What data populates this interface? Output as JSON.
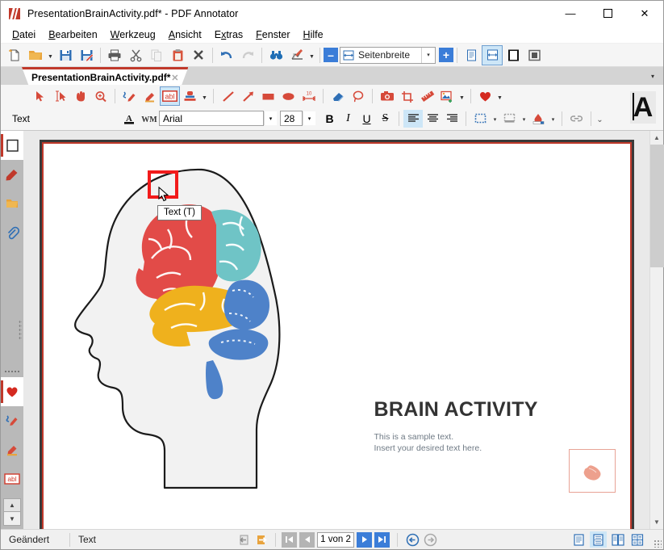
{
  "window": {
    "title": "PresentationBrainActivity.pdf* - PDF Annotator",
    "app_icon": "pdf-annotator-logo-icon",
    "minimize_label": "—",
    "maximize_label": "☐",
    "close_label": "✕"
  },
  "menubar": {
    "items": [
      {
        "label": "Datei",
        "accel": "D"
      },
      {
        "label": "Bearbeiten",
        "accel": "B"
      },
      {
        "label": "Werkzeug",
        "accel": "W"
      },
      {
        "label": "Ansicht",
        "accel": "A"
      },
      {
        "label": "Extras",
        "accel": "x"
      },
      {
        "label": "Fenster",
        "accel": "F"
      },
      {
        "label": "Hilfe",
        "accel": "H"
      }
    ]
  },
  "toolbar_main": {
    "buttons": [
      {
        "name": "new-document-icon",
        "glyph": "὜B",
        "enabled": true
      },
      {
        "name": "open-folder-icon",
        "glyph": "folder",
        "enabled": true
      },
      {
        "name": "open-dropdown-icon",
        "glyph": "▼",
        "enabled": true
      },
      {
        "name": "save-icon",
        "glyph": "save",
        "enabled": true
      },
      {
        "name": "save-as-icon",
        "glyph": "save-as",
        "enabled": true
      },
      {
        "name": "print-icon",
        "glyph": "printer",
        "enabled": true
      },
      {
        "name": "cut-icon",
        "glyph": "scissors",
        "enabled": true
      },
      {
        "name": "copy-icon",
        "glyph": "copy",
        "enabled": false
      },
      {
        "name": "paste-icon",
        "glyph": "clipboard",
        "enabled": true
      },
      {
        "name": "delete-icon",
        "glyph": "✕",
        "enabled": true
      },
      {
        "name": "undo-icon",
        "glyph": "undo",
        "enabled": true
      },
      {
        "name": "redo-icon",
        "glyph": "redo",
        "enabled": false
      },
      {
        "name": "find-icon",
        "glyph": "binoculars",
        "enabled": true
      },
      {
        "name": "chart-icon",
        "glyph": "chart",
        "enabled": true
      }
    ],
    "zoom": {
      "minus_label": "–",
      "plus_label": "+",
      "value": "Seitenbreite",
      "icon": "fit-width-icon",
      "dropdown_label": "▾"
    },
    "view_modes": [
      {
        "name": "single-page-view-icon",
        "active": false
      },
      {
        "name": "fit-width-view-icon",
        "active": true
      },
      {
        "name": "full-page-view-icon",
        "active": false
      },
      {
        "name": "window-view-icon",
        "active": false
      }
    ]
  },
  "tabstrip": {
    "tab_label": "PresentationBrainActivity.pdf*",
    "tab_close": "✕",
    "overflow_arrow": "▾"
  },
  "annotation_toolbar": {
    "row1": [
      {
        "name": "select-pointer-tool",
        "active": false
      },
      {
        "name": "text-select-tool",
        "active": false
      },
      {
        "name": "hand-pan-tool",
        "active": false
      },
      {
        "name": "zoom-tool",
        "active": false
      },
      {
        "name": "pen-tool",
        "active": false
      },
      {
        "name": "highlighter-tool",
        "active": false
      },
      {
        "name": "text-tool",
        "active": true,
        "label": "abl"
      },
      {
        "name": "stamp-tool",
        "active": false
      },
      {
        "name": "stamp-dropdown",
        "active": false,
        "label": "▾"
      },
      {
        "name": "line-tool",
        "active": false
      },
      {
        "name": "arrow-tool",
        "active": false
      },
      {
        "name": "rectangle-tool",
        "active": false
      },
      {
        "name": "ellipse-tool",
        "active": false
      },
      {
        "name": "measure-tool",
        "active": false
      },
      {
        "name": "eraser-tool",
        "active": false
      },
      {
        "name": "lasso-tool",
        "active": false
      },
      {
        "name": "snapshot-tool",
        "active": false
      },
      {
        "name": "crop-tool",
        "active": false
      },
      {
        "name": "ruler-tool",
        "active": false
      },
      {
        "name": "insert-image-tool",
        "active": false
      },
      {
        "name": "insert-image-dropdown",
        "active": false,
        "label": "▾"
      },
      {
        "name": "favorites-heart-tool",
        "active": false
      },
      {
        "name": "favorites-dropdown",
        "active": false,
        "label": "▾"
      }
    ],
    "row2": {
      "mode_label": "Text",
      "font_color_icon": "font-color-icon",
      "font_name": "Arial",
      "font_size": "28",
      "combo_arrow": "▾",
      "bold_label": "B",
      "italic_label": "I",
      "underline_label": "U",
      "strike_label": "S",
      "align": [
        {
          "name": "align-left-button",
          "active": true
        },
        {
          "name": "align-center-button",
          "active": false
        },
        {
          "name": "align-right-button",
          "active": false
        }
      ],
      "border_style_label": "▾",
      "fill_style_label": "▾",
      "fill_color_label": "▾",
      "link_icon": "link-icon",
      "more_arrow": "⌄"
    },
    "big_letter": "A"
  },
  "tooltip": {
    "text": "Text (T)"
  },
  "left_rail": {
    "items": [
      {
        "name": "rail-page-thumbnails",
        "selected": true,
        "icon": "page-icon"
      },
      {
        "name": "rail-bookmark",
        "selected": false,
        "icon": "bookmark-icon"
      },
      {
        "name": "rail-pages-folder",
        "selected": false,
        "icon": "folder-icon"
      },
      {
        "name": "rail-attachments",
        "selected": false,
        "icon": "paperclip-icon"
      }
    ],
    "items_lower": [
      {
        "name": "rail-favorites",
        "selected": true,
        "icon": "heart-icon"
      },
      {
        "name": "rail-pen",
        "selected": false,
        "icon": "pen-icon"
      },
      {
        "name": "rail-highlighter",
        "selected": false,
        "icon": "highlighter-icon"
      },
      {
        "name": "rail-text-tool",
        "selected": false,
        "icon": "abl-icon",
        "label": "abl"
      }
    ],
    "scroll_up": "▲",
    "scroll_down": "▼"
  },
  "document": {
    "heading": "BRAIN ACTIVITY",
    "body_line1": "This is a sample text.",
    "body_line2": "Insert your desired text here.",
    "graphic_name": "head-with-colored-brain-illustration",
    "hand_box_icon": "hand-pointing-icon",
    "brain_colors": {
      "frontal_lobe": "#e24b48",
      "parietal_lobe": "#6fc4c6",
      "temporal_lobe": "#efb11d",
      "cerebellum": "#4e82c9",
      "head_fill": "#f2f2f2",
      "head_outline": "#1b1b1b"
    },
    "page_border_color": "#c0392b",
    "page_frame_color": "#3a3a3a"
  },
  "statusbar": {
    "state": "Geändert",
    "mode": "Text",
    "page_indicator": "1 von 2",
    "nav": {
      "prev_view_icon": "previous-view-icon",
      "next_view_icon": "next-view-icon",
      "first_page_label": "⏮",
      "prev_page_label": "◀",
      "next_page_label": "▶",
      "last_page_label": "⏭",
      "back_label": "←",
      "forward_label": "→"
    },
    "views": [
      {
        "name": "view-single-page-button",
        "active": false
      },
      {
        "name": "view-continuous-button",
        "active": true
      },
      {
        "name": "view-facing-button",
        "active": false
      },
      {
        "name": "view-grid-button",
        "active": false
      }
    ]
  },
  "scrollbar": {
    "up_label": "▲",
    "down_label": "▼"
  },
  "colors": {
    "accent_red": "#c0392b",
    "accent_blue": "#3b7dd8",
    "highlight_blue": "#cde6f7",
    "toolbar_bg": "#f5f5f5",
    "canvas_bg": "#e9e9e9"
  }
}
